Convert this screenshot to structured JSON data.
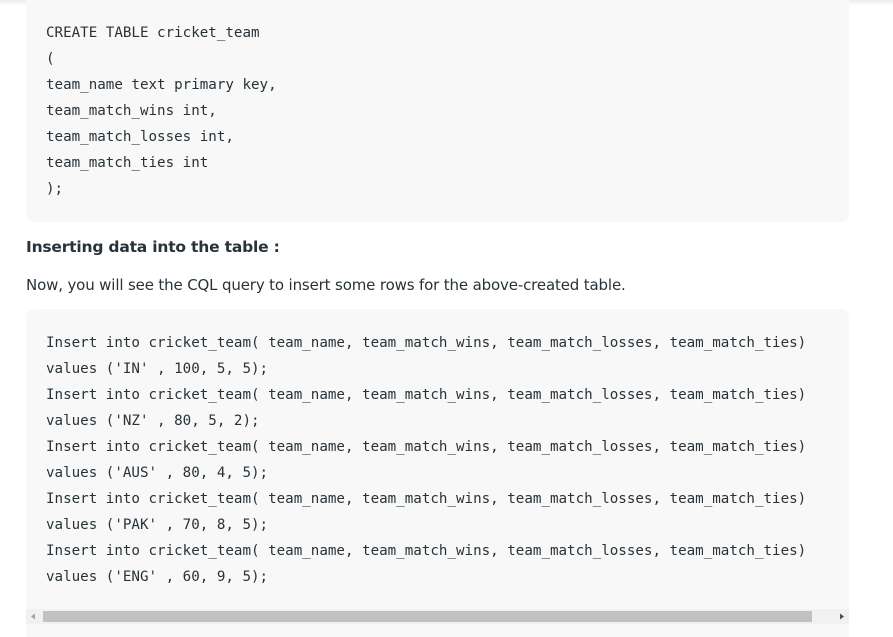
{
  "create_table_code": {
    "lines": [
      "CREATE TABLE cricket_team",
      "(",
      "team_name text primary key,",
      "team_match_wins int,",
      "team_match_losses int,",
      "team_match_ties int",
      ");"
    ]
  },
  "section": {
    "heading": "Inserting data into the table :",
    "paragraph": "Now, you will see the CQL query to insert some rows for the above-created table."
  },
  "insert_code": {
    "lines": [
      "Insert into cricket_team( team_name, team_match_wins, team_match_losses, team_match_ties)",
      "values ('IN' , 100, 5, 5);",
      "Insert into cricket_team( team_name, team_match_wins, team_match_losses, team_match_ties)",
      "values ('NZ' , 80, 5, 2);",
      "Insert into cricket_team( team_name, team_match_wins, team_match_losses, team_match_ties)",
      "values ('AUS' , 80, 4, 5);",
      "Insert into cricket_team( team_name, team_match_wins, team_match_losses, team_match_ties)",
      "values ('PAK' , 70, 8, 5);",
      "Insert into cricket_team( team_name, team_match_wins, team_match_losses, team_match_ties)",
      "values ('ENG' , 60, 9, 5);"
    ]
  },
  "scrollbar": {
    "left_arrow_icon": "scroll-left-arrow-icon",
    "right_arrow_icon": "scroll-right-arrow-icon",
    "position_fraction": 0.0
  },
  "colors": {
    "text": "#273239",
    "code_background": "#f8f8f8",
    "scrollbar_track": "#f1f1f1",
    "scrollbar_thumb": "#c1c1c1"
  }
}
